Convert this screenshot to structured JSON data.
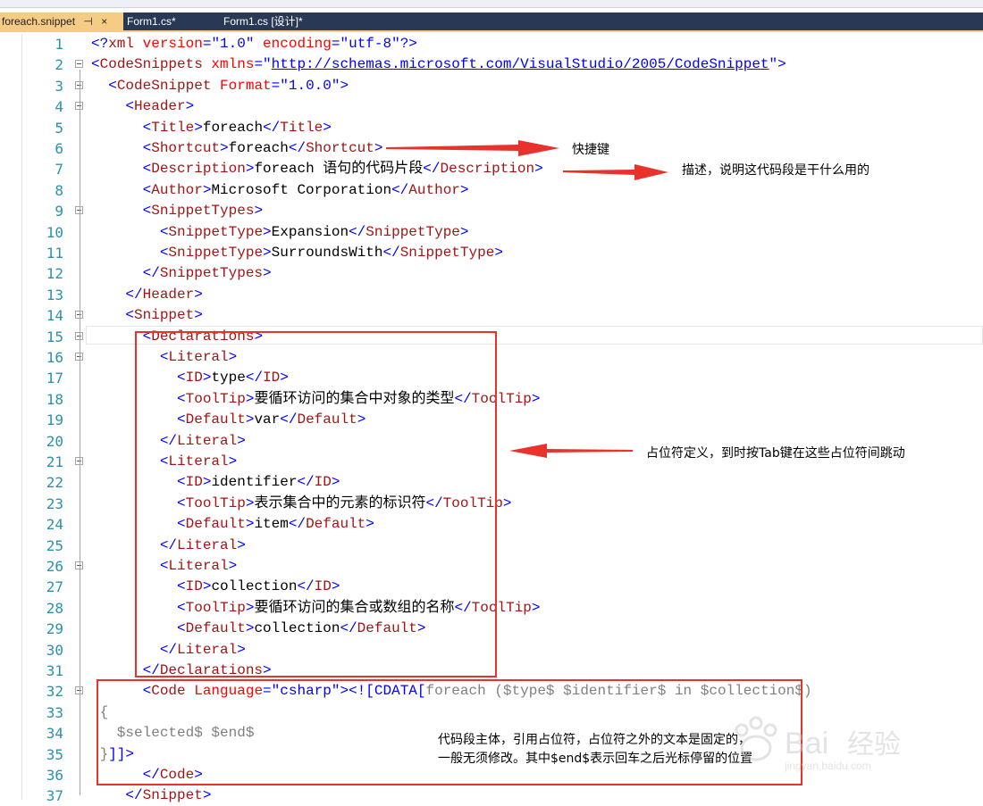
{
  "tabs": [
    {
      "label": "foreach.snippet",
      "pin": "⊣",
      "close": "×",
      "active": true
    },
    {
      "label": "Form1.cs*",
      "active": false
    },
    {
      "label": "Form1.cs [设计]*",
      "active": false
    }
  ],
  "code_lines": [
    {
      "n": "1",
      "fold": false,
      "segs": [
        [
          "b",
          "<?"
        ],
        [
          "t",
          "xml"
        ],
        [
          "a",
          " version"
        ],
        [
          "b",
          "="
        ],
        [
          "s",
          "\"1.0\""
        ],
        [
          "a",
          " encoding"
        ],
        [
          "b",
          "="
        ],
        [
          "s",
          "\"utf-8\""
        ],
        [
          "b",
          "?>"
        ]
      ]
    },
    {
      "n": "2",
      "fold": true,
      "segs": [
        [
          "b",
          "<"
        ],
        [
          "t",
          "CodeSnippets"
        ],
        [
          "a",
          " xmlns"
        ],
        [
          "b",
          "=\""
        ],
        [
          "u",
          "http://schemas.microsoft.com/VisualStudio/2005/CodeSnippet"
        ],
        [
          "b",
          "\">"
        ]
      ]
    },
    {
      "n": "3",
      "fold": true,
      "segs": [
        [
          "b",
          "  <"
        ],
        [
          "t",
          "CodeSnippet"
        ],
        [
          "a",
          " Format"
        ],
        [
          "b",
          "="
        ],
        [
          "s",
          "\"1.0.0\""
        ],
        [
          "b",
          ">"
        ]
      ]
    },
    {
      "n": "4",
      "fold": true,
      "segs": [
        [
          "b",
          "    <"
        ],
        [
          "t",
          "Header"
        ],
        [
          "b",
          ">"
        ]
      ]
    },
    {
      "n": "5",
      "fold": false,
      "segs": [
        [
          "b",
          "      <"
        ],
        [
          "t",
          "Title"
        ],
        [
          "b",
          ">"
        ],
        [
          "k",
          "foreach"
        ],
        [
          "b",
          "</"
        ],
        [
          "t",
          "Title"
        ],
        [
          "b",
          ">"
        ]
      ]
    },
    {
      "n": "6",
      "fold": false,
      "segs": [
        [
          "b",
          "      <"
        ],
        [
          "t",
          "Shortcut"
        ],
        [
          "b",
          ">"
        ],
        [
          "k",
          "foreach"
        ],
        [
          "b",
          "</"
        ],
        [
          "t",
          "Shortcut"
        ],
        [
          "b",
          ">"
        ]
      ]
    },
    {
      "n": "7",
      "fold": false,
      "segs": [
        [
          "b",
          "      <"
        ],
        [
          "t",
          "Description"
        ],
        [
          "b",
          ">"
        ],
        [
          "k",
          "foreach 语句的代码片段"
        ],
        [
          "b",
          "</"
        ],
        [
          "t",
          "Description"
        ],
        [
          "b",
          ">"
        ]
      ]
    },
    {
      "n": "8",
      "fold": false,
      "segs": [
        [
          "b",
          "      <"
        ],
        [
          "t",
          "Author"
        ],
        [
          "b",
          ">"
        ],
        [
          "k",
          "Microsoft Corporation"
        ],
        [
          "b",
          "</"
        ],
        [
          "t",
          "Author"
        ],
        [
          "b",
          ">"
        ]
      ]
    },
    {
      "n": "9",
      "fold": true,
      "segs": [
        [
          "b",
          "      <"
        ],
        [
          "t",
          "SnippetTypes"
        ],
        [
          "b",
          ">"
        ]
      ]
    },
    {
      "n": "10",
      "fold": false,
      "segs": [
        [
          "b",
          "        <"
        ],
        [
          "t",
          "SnippetType"
        ],
        [
          "b",
          ">"
        ],
        [
          "k",
          "Expansion"
        ],
        [
          "b",
          "</"
        ],
        [
          "t",
          "SnippetType"
        ],
        [
          "b",
          ">"
        ]
      ]
    },
    {
      "n": "11",
      "fold": false,
      "segs": [
        [
          "b",
          "        <"
        ],
        [
          "t",
          "SnippetType"
        ],
        [
          "b",
          ">"
        ],
        [
          "k",
          "SurroundsWith"
        ],
        [
          "b",
          "</"
        ],
        [
          "t",
          "SnippetType"
        ],
        [
          "b",
          ">"
        ]
      ]
    },
    {
      "n": "12",
      "fold": false,
      "segs": [
        [
          "b",
          "      </"
        ],
        [
          "t",
          "SnippetTypes"
        ],
        [
          "b",
          ">"
        ]
      ]
    },
    {
      "n": "13",
      "fold": false,
      "segs": [
        [
          "b",
          "    </"
        ],
        [
          "t",
          "Header"
        ],
        [
          "b",
          ">"
        ]
      ]
    },
    {
      "n": "14",
      "fold": true,
      "segs": [
        [
          "b",
          "    <"
        ],
        [
          "t",
          "Snippet"
        ],
        [
          "b",
          ">"
        ]
      ]
    },
    {
      "n": "15",
      "fold": true,
      "segs": [
        [
          "b",
          "      <"
        ],
        [
          "t",
          "Declarations"
        ],
        [
          "b",
          ">"
        ]
      ]
    },
    {
      "n": "16",
      "fold": true,
      "segs": [
        [
          "b",
          "        <"
        ],
        [
          "t",
          "Literal"
        ],
        [
          "b",
          ">"
        ]
      ]
    },
    {
      "n": "17",
      "fold": false,
      "segs": [
        [
          "b",
          "          <"
        ],
        [
          "t",
          "ID"
        ],
        [
          "b",
          ">"
        ],
        [
          "k",
          "type"
        ],
        [
          "b",
          "</"
        ],
        [
          "t",
          "ID"
        ],
        [
          "b",
          ">"
        ]
      ]
    },
    {
      "n": "18",
      "fold": false,
      "segs": [
        [
          "b",
          "          <"
        ],
        [
          "t",
          "ToolTip"
        ],
        [
          "b",
          ">"
        ],
        [
          "k",
          "要循环访问的集合中对象的类型"
        ],
        [
          "b",
          "</"
        ],
        [
          "t",
          "ToolTip"
        ],
        [
          "b",
          ">"
        ]
      ]
    },
    {
      "n": "19",
      "fold": false,
      "segs": [
        [
          "b",
          "          <"
        ],
        [
          "t",
          "Default"
        ],
        [
          "b",
          ">"
        ],
        [
          "k",
          "var"
        ],
        [
          "b",
          "</"
        ],
        [
          "t",
          "Default"
        ],
        [
          "b",
          ">"
        ]
      ]
    },
    {
      "n": "20",
      "fold": false,
      "segs": [
        [
          "b",
          "        </"
        ],
        [
          "t",
          "Literal"
        ],
        [
          "b",
          ">"
        ]
      ]
    },
    {
      "n": "21",
      "fold": true,
      "segs": [
        [
          "b",
          "        <"
        ],
        [
          "t",
          "Literal"
        ],
        [
          "b",
          ">"
        ]
      ]
    },
    {
      "n": "22",
      "fold": false,
      "segs": [
        [
          "b",
          "          <"
        ],
        [
          "t",
          "ID"
        ],
        [
          "b",
          ">"
        ],
        [
          "k",
          "identifier"
        ],
        [
          "b",
          "</"
        ],
        [
          "t",
          "ID"
        ],
        [
          "b",
          ">"
        ]
      ]
    },
    {
      "n": "23",
      "fold": false,
      "segs": [
        [
          "b",
          "          <"
        ],
        [
          "t",
          "ToolTip"
        ],
        [
          "b",
          ">"
        ],
        [
          "k",
          "表示集合中的元素的标识符"
        ],
        [
          "b",
          "</"
        ],
        [
          "t",
          "ToolTip"
        ],
        [
          "b",
          ">"
        ]
      ]
    },
    {
      "n": "24",
      "fold": false,
      "segs": [
        [
          "b",
          "          <"
        ],
        [
          "t",
          "Default"
        ],
        [
          "b",
          ">"
        ],
        [
          "k",
          "item"
        ],
        [
          "b",
          "</"
        ],
        [
          "t",
          "Default"
        ],
        [
          "b",
          ">"
        ]
      ]
    },
    {
      "n": "25",
      "fold": false,
      "segs": [
        [
          "b",
          "        </"
        ],
        [
          "t",
          "Literal"
        ],
        [
          "b",
          ">"
        ]
      ]
    },
    {
      "n": "26",
      "fold": true,
      "segs": [
        [
          "b",
          "        <"
        ],
        [
          "t",
          "Literal"
        ],
        [
          "b",
          ">"
        ]
      ]
    },
    {
      "n": "27",
      "fold": false,
      "segs": [
        [
          "b",
          "          <"
        ],
        [
          "t",
          "ID"
        ],
        [
          "b",
          ">"
        ],
        [
          "k",
          "collection"
        ],
        [
          "b",
          "</"
        ],
        [
          "t",
          "ID"
        ],
        [
          "b",
          ">"
        ]
      ]
    },
    {
      "n": "28",
      "fold": false,
      "segs": [
        [
          "b",
          "          <"
        ],
        [
          "t",
          "ToolTip"
        ],
        [
          "b",
          ">"
        ],
        [
          "k",
          "要循环访问的集合或数组的名称"
        ],
        [
          "b",
          "</"
        ],
        [
          "t",
          "ToolTip"
        ],
        [
          "b",
          ">"
        ]
      ]
    },
    {
      "n": "29",
      "fold": false,
      "segs": [
        [
          "b",
          "          <"
        ],
        [
          "t",
          "Default"
        ],
        [
          "b",
          ">"
        ],
        [
          "k",
          "collection"
        ],
        [
          "b",
          "</"
        ],
        [
          "t",
          "Default"
        ],
        [
          "b",
          ">"
        ]
      ]
    },
    {
      "n": "30",
      "fold": false,
      "segs": [
        [
          "b",
          "        </"
        ],
        [
          "t",
          "Literal"
        ],
        [
          "b",
          ">"
        ]
      ]
    },
    {
      "n": "31",
      "fold": false,
      "segs": [
        [
          "b",
          "      </"
        ],
        [
          "t",
          "Declarations"
        ],
        [
          "b",
          ">"
        ]
      ]
    },
    {
      "n": "32",
      "fold": true,
      "segs": [
        [
          "b",
          "      <"
        ],
        [
          "t",
          "Code"
        ],
        [
          "a",
          " Language"
        ],
        [
          "b",
          "="
        ],
        [
          "s",
          "\"csharp\""
        ],
        [
          "b",
          ">"
        ],
        [
          "b",
          "<![CDATA["
        ],
        [
          "g",
          "foreach ($type$ $identifier$ in $collection$)"
        ]
      ]
    },
    {
      "n": "33",
      "fold": false,
      "segs": [
        [
          "g",
          " {"
        ]
      ]
    },
    {
      "n": "34",
      "fold": false,
      "segs": [
        [
          "g",
          "   $selected$ $end$"
        ]
      ]
    },
    {
      "n": "35",
      "fold": false,
      "segs": [
        [
          "g",
          " }"
        ],
        [
          "b",
          "]]>"
        ]
      ]
    },
    {
      "n": "36",
      "fold": false,
      "segs": [
        [
          "b",
          "      </"
        ],
        [
          "t",
          "Code"
        ],
        [
          "b",
          ">"
        ]
      ]
    },
    {
      "n": "37",
      "fold": false,
      "segs": [
        [
          "b",
          "    </"
        ],
        [
          "t",
          "Snippet"
        ],
        [
          "b",
          ">"
        ]
      ]
    }
  ],
  "annotations": {
    "shortcut": "快捷键",
    "description": "描述，说明这代码段是干什么用的",
    "placeholders": "占位符定义，到时按Tab键在这些占位符间跳动",
    "body_line1": "代码段主体，引用占位符，占位符之外的文本是固定的，",
    "body_line2": "一般无须修改。其中$end$表示回车之后光标停留的位置"
  },
  "watermark": "Bai 经验",
  "colors": {
    "tag_bracket": "#0000ff",
    "tag_name": "#a31515",
    "attribute": "#ff0000",
    "cdata_text": "#808080",
    "annotation_red": "#e8322c",
    "tab_active": "#f5cc84",
    "tab_bar": "#293955"
  }
}
